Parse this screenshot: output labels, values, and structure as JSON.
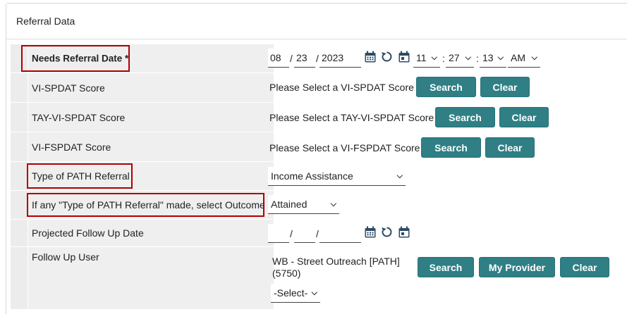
{
  "panel": {
    "title": "Referral Data"
  },
  "rows": {
    "needs_referral_date": {
      "label": "Needs Referral Date *",
      "month": "08",
      "day": "23",
      "year": "2023",
      "hour": "11",
      "minute": "27",
      "second": "13",
      "ampm": "AM"
    },
    "vi_spdat": {
      "label": "VI-SPDAT Score",
      "value": "Please Select a VI-SPDAT Score",
      "search_label": "Search",
      "clear_label": "Clear"
    },
    "tay_vi_spdat": {
      "label": "TAY-VI-SPDAT Score",
      "value": "Please Select a TAY-VI-SPDAT Score",
      "search_label": "Search",
      "clear_label": "Clear"
    },
    "vi_fspdat": {
      "label": "VI-FSPDAT Score",
      "value": "Please Select a VI-FSPDAT Score",
      "search_label": "Search",
      "clear_label": "Clear"
    },
    "type_of_path_referral": {
      "label": "Type of PATH Referral",
      "selected": "Income Assistance"
    },
    "outcome": {
      "label": "If any \"Type of PATH Referral\" made, select Outcome",
      "selected": "Attained"
    },
    "projected_follow_up": {
      "label": "Projected Follow Up Date",
      "month": "",
      "day": "",
      "year": ""
    },
    "follow_up_user": {
      "label": "Follow Up User",
      "value_line1": "WB - Street Outreach [PATH]",
      "value_line2": "(5750)",
      "search_label": "Search",
      "my_provider_label": "My Provider",
      "clear_label": "Clear",
      "select_value": "-Select-"
    }
  },
  "colors": {
    "button": "#2f7f85",
    "highlight": "#b00000",
    "label_bg": "#efefef"
  },
  "icons": [
    "calendar-icon",
    "reset-icon",
    "clock-calendar-icon",
    "chevron-down-icon"
  ]
}
